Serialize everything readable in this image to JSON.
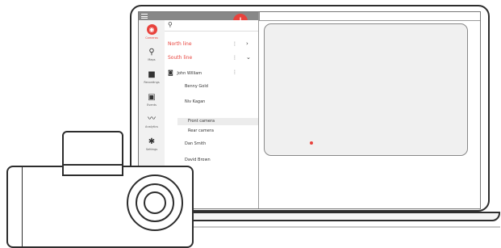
{
  "app": {
    "add_button_label": "+",
    "search_icon": "search-icon",
    "menu_icon": "hamburger-icon"
  },
  "sidebar": {
    "items": [
      {
        "label": "Cameras",
        "icon": "camera-icon",
        "glyph": "◉",
        "active": true
      },
      {
        "label": "Maps",
        "icon": "map-pin-icon",
        "glyph": "⚲"
      },
      {
        "label": "Recordings",
        "icon": "video-icon",
        "glyph": "■"
      },
      {
        "label": "Events",
        "icon": "calendar-icon",
        "glyph": "▣"
      },
      {
        "label": "Analytics",
        "icon": "chart-icon",
        "glyph": "〰"
      },
      {
        "label": "Settings",
        "icon": "gear-icon",
        "glyph": "✱"
      }
    ]
  },
  "list": {
    "groups": [
      {
        "label": "North line",
        "menu": "⋮",
        "chevron": "›"
      },
      {
        "label": "South line",
        "menu": "⋮",
        "chevron": "⌄"
      }
    ],
    "owner": {
      "label": "John William",
      "menu": "⋮"
    },
    "people": [
      "Benny Gold",
      "Niv Kagan",
      "Dan Smith",
      "David Brown"
    ],
    "cameras": [
      "Front camera",
      "Rear camera"
    ]
  },
  "colors": {
    "accent": "#e8423c"
  }
}
